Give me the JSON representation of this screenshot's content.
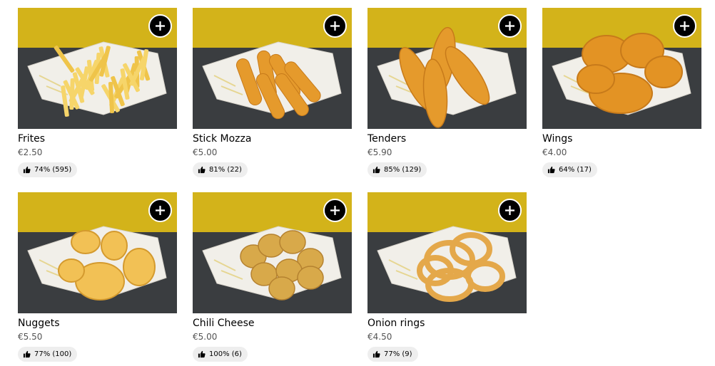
{
  "items": [
    {
      "name": "Frites",
      "price": "€2.50",
      "rating": "74% (595)",
      "food": "fries"
    },
    {
      "name": "Stick Mozza",
      "price": "€5.00",
      "rating": "81% (22)",
      "food": "sticks"
    },
    {
      "name": "Tenders",
      "price": "€5.90",
      "rating": "85% (129)",
      "food": "tenders"
    },
    {
      "name": "Wings",
      "price": "€4.00",
      "rating": "64% (17)",
      "food": "wings"
    },
    {
      "name": "Nuggets",
      "price": "€5.50",
      "rating": "77% (100)",
      "food": "nuggets"
    },
    {
      "name": "Chili Cheese",
      "price": "€5.00",
      "rating": "100% (6)",
      "food": "chili-cheese"
    },
    {
      "name": "Onion rings",
      "price": "€4.50",
      "rating": "77% (9)",
      "food": "onion-rings"
    }
  ],
  "icons": {
    "add": "plus-icon",
    "rating": "thumbs-up-icon"
  },
  "colors": {
    "wall": "#d3b31a",
    "counter": "#3a3d40",
    "food": "#e59a2c",
    "button": "#000000",
    "rating_pill": "#eeeeee"
  }
}
